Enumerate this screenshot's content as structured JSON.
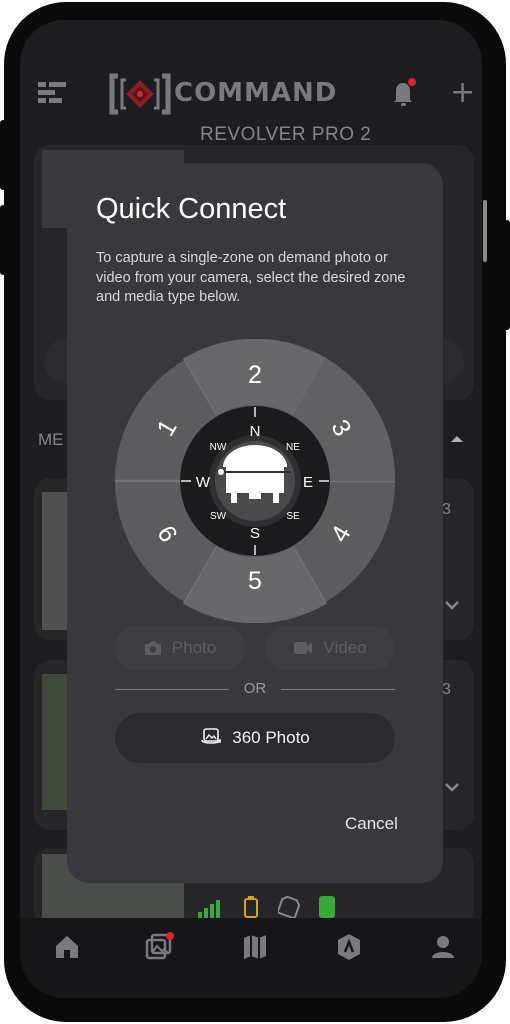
{
  "header": {
    "logo_text": "COMMAND",
    "camera_name": "REVOLVER PRO 2"
  },
  "background": {
    "section_label": "ME",
    "count_badge_1": "3",
    "count_badge_2": "3"
  },
  "dialog": {
    "title": "Quick Connect",
    "description": "To capture a single-zone on demand photo or video from your camera, select the desired zone and media type below.",
    "zones": [
      "1",
      "2",
      "3",
      "4",
      "5",
      "6"
    ],
    "compass": {
      "n": "N",
      "ne": "NE",
      "e": "E",
      "se": "SE",
      "s": "S",
      "sw": "SW",
      "w": "W",
      "nw": "NW"
    },
    "photo_label": "Photo",
    "video_label": "Video",
    "or_label": "OR",
    "photo360_label": "360 Photo",
    "cancel_label": "Cancel"
  },
  "tabs": [
    "home",
    "gallery",
    "map",
    "stats",
    "profile"
  ],
  "colors": {
    "accent_red": "#e2222a",
    "dialog_bg": "#39393d",
    "wheel_outer": "#5c5c5f",
    "wheel_inner": "#1b1b1d"
  }
}
